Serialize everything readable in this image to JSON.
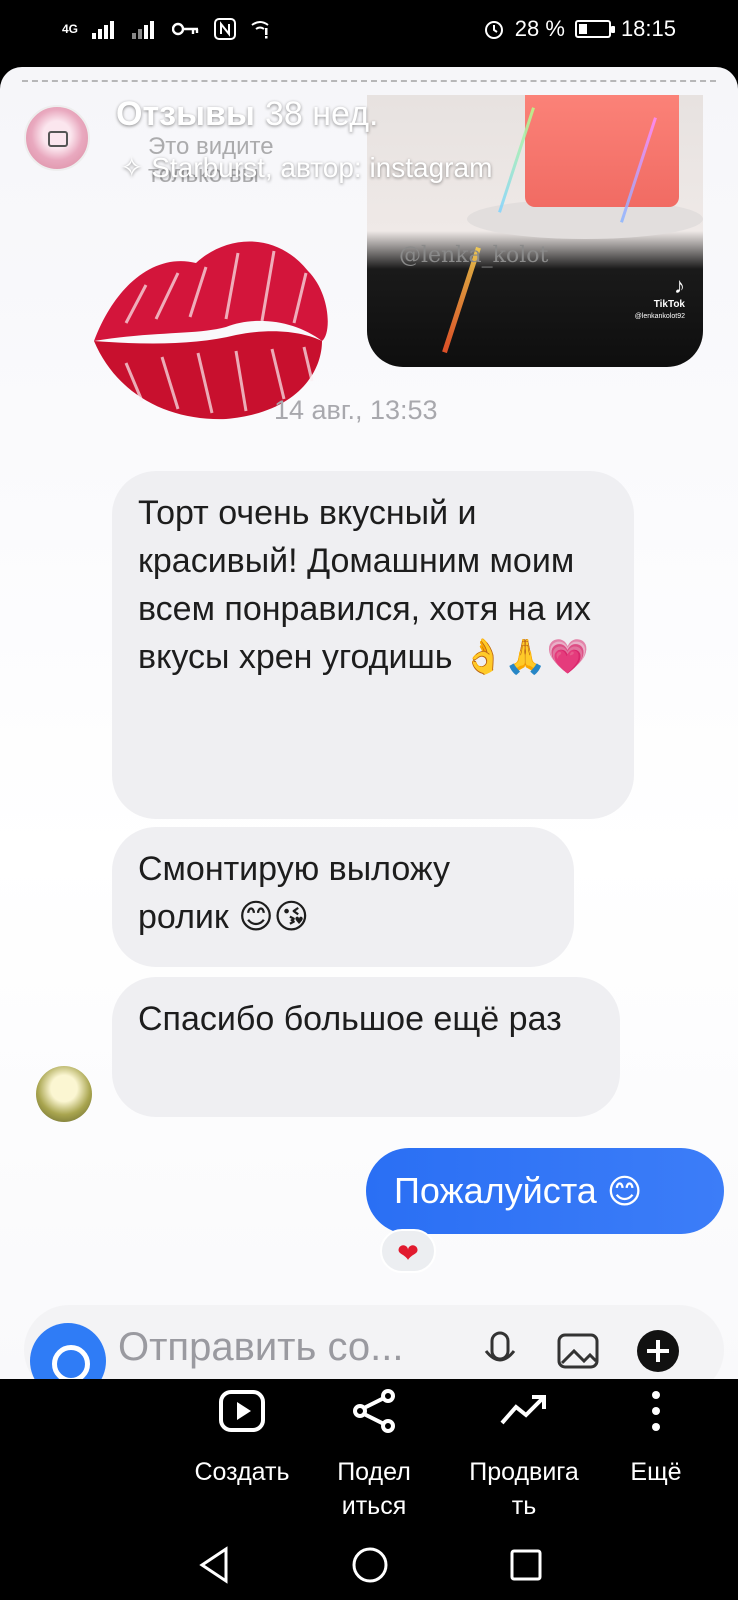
{
  "status_bar": {
    "network": "4G",
    "battery": "28 %",
    "battery_level": 0.28,
    "time": "18:15"
  },
  "story": {
    "title": "Отзывы",
    "age": "38 нед.",
    "effect_line": "Starburst, автор: instagram",
    "ghost_text": "Это видите только вы",
    "watermark": "@lenka_kolot",
    "tiktok_label": "TikTok",
    "tiktok_user": "@lenkankolot92"
  },
  "chat": {
    "timestamp": "14 авг., 13:53",
    "messages": [
      {
        "from": "them",
        "text": "Торт очень вкусный и красивый! Домашним моим всем понравился, хотя на их вкусы хрен угодишь",
        "emoji": "👌🙏💗"
      },
      {
        "from": "them",
        "text": "Смонтирую выложу ролик",
        "emoji": "😊😘"
      },
      {
        "from": "them",
        "text": "Спасибо большое ещё раз",
        "emoji": ""
      },
      {
        "from": "me",
        "text": "Пожалуйста",
        "emoji": "😊"
      }
    ],
    "reaction": "❤",
    "composer_placeholder": "Отправить со..."
  },
  "actions": [
    {
      "label": "Создать",
      "icon": "play-icon"
    },
    {
      "label": "Подел иться",
      "icon": "share-icon"
    },
    {
      "label": "Продвига ть",
      "icon": "trend-icon"
    },
    {
      "label": "Ещё",
      "icon": "more-icon"
    }
  ],
  "colors": {
    "accent_blue": "#2f7cf6",
    "bubble_gray": "#efeff2",
    "lips_red": "#d3153b"
  }
}
